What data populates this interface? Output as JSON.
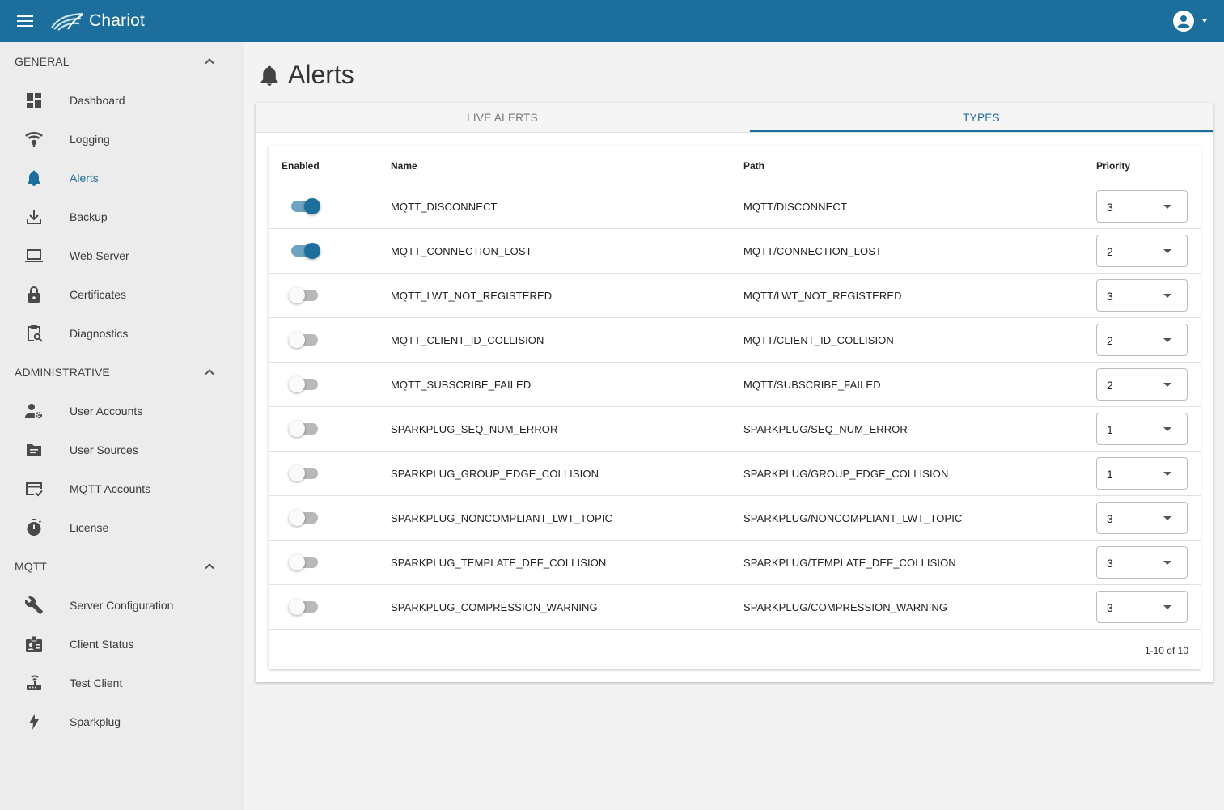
{
  "app": {
    "title": "Chariot"
  },
  "colors": {
    "brand": "#1c6e9c",
    "toggle_on_track": "#6fa3c2",
    "toggle_off_track": "#b8b8b8"
  },
  "sidebar": {
    "sections": [
      {
        "title": "GENERAL",
        "items": [
          {
            "label": "Dashboard",
            "icon": "dashboard-icon"
          },
          {
            "label": "Logging",
            "icon": "logging-icon"
          },
          {
            "label": "Alerts",
            "icon": "bell-icon",
            "active": true
          },
          {
            "label": "Backup",
            "icon": "download-icon"
          },
          {
            "label": "Web Server",
            "icon": "laptop-icon"
          },
          {
            "label": "Certificates",
            "icon": "lock-icon"
          },
          {
            "label": "Diagnostics",
            "icon": "clipboard-search-icon"
          }
        ]
      },
      {
        "title": "ADMINISTRATIVE",
        "items": [
          {
            "label": "User Accounts",
            "icon": "user-gear-icon"
          },
          {
            "label": "User Sources",
            "icon": "folder-icon"
          },
          {
            "label": "MQTT Accounts",
            "icon": "card-check-icon"
          },
          {
            "label": "License",
            "icon": "stopwatch-icon"
          }
        ]
      },
      {
        "title": "MQTT",
        "items": [
          {
            "label": "Server Configuration",
            "icon": "wrench-icon"
          },
          {
            "label": "Client Status",
            "icon": "badge-icon"
          },
          {
            "label": "Test Client",
            "icon": "router-icon"
          },
          {
            "label": "Sparkplug",
            "icon": "bolt-icon"
          }
        ]
      }
    ]
  },
  "page": {
    "title": "Alerts"
  },
  "tabs": [
    {
      "label": "LIVE ALERTS"
    },
    {
      "label": "TYPES",
      "active": true
    }
  ],
  "table": {
    "columns": [
      "Enabled",
      "Name",
      "Path",
      "Priority"
    ],
    "rows": [
      {
        "enabled": true,
        "name": "MQTT_DISCONNECT",
        "path": "MQTT/DISCONNECT",
        "priority": "3"
      },
      {
        "enabled": true,
        "name": "MQTT_CONNECTION_LOST",
        "path": "MQTT/CONNECTION_LOST",
        "priority": "2"
      },
      {
        "enabled": false,
        "name": "MQTT_LWT_NOT_REGISTERED",
        "path": "MQTT/LWT_NOT_REGISTERED",
        "priority": "3"
      },
      {
        "enabled": false,
        "name": "MQTT_CLIENT_ID_COLLISION",
        "path": "MQTT/CLIENT_ID_COLLISION",
        "priority": "2"
      },
      {
        "enabled": false,
        "name": "MQTT_SUBSCRIBE_FAILED",
        "path": "MQTT/SUBSCRIBE_FAILED",
        "priority": "2"
      },
      {
        "enabled": false,
        "name": "SPARKPLUG_SEQ_NUM_ERROR",
        "path": "SPARKPLUG/SEQ_NUM_ERROR",
        "priority": "1"
      },
      {
        "enabled": false,
        "name": "SPARKPLUG_GROUP_EDGE_COLLISION",
        "path": "SPARKPLUG/GROUP_EDGE_COLLISION",
        "priority": "1"
      },
      {
        "enabled": false,
        "name": "SPARKPLUG_NONCOMPLIANT_LWT_TOPIC",
        "path": "SPARKPLUG/NONCOMPLIANT_LWT_TOPIC",
        "priority": "3"
      },
      {
        "enabled": false,
        "name": "SPARKPLUG_TEMPLATE_DEF_COLLISION",
        "path": "SPARKPLUG/TEMPLATE_DEF_COLLISION",
        "priority": "3"
      },
      {
        "enabled": false,
        "name": "SPARKPLUG_COMPRESSION_WARNING",
        "path": "SPARKPLUG/COMPRESSION_WARNING",
        "priority": "3"
      }
    ],
    "pagination": "1-10 of 10"
  }
}
